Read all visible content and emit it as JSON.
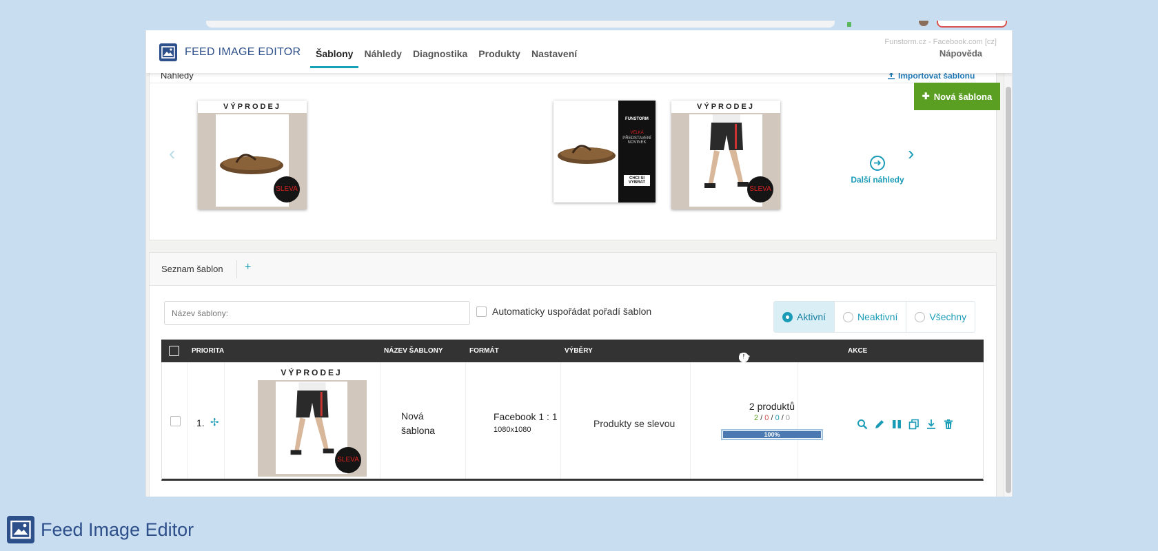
{
  "app": {
    "brand": "FEED IMAGE EDITOR",
    "account": "Funstorm.cz - Facebook.com [cz]",
    "help": "Nápověda",
    "tabs": [
      {
        "label": "Šablony",
        "active": true
      },
      {
        "label": "Náhledy",
        "active": false
      },
      {
        "label": "Diagnostika",
        "active": false
      },
      {
        "label": "Produkty",
        "active": false
      },
      {
        "label": "Nastavení",
        "active": false
      }
    ]
  },
  "previews": {
    "title": "Náhledy",
    "import_label": "Importovat šablonu",
    "new_template_label": "Nová šablona",
    "next_label": "Další náhledy",
    "banner_text": "VÝPRODEJ",
    "badge_text": "SLEVA",
    "side_banner": {
      "brand": "FUNSTORM",
      "lines": [
        "VELKÁ",
        "PŘEDSTAVENÍ NOVINEK"
      ],
      "cta": "CHCI SI VYBRAT"
    }
  },
  "list": {
    "title": "Seznam šablon",
    "search_placeholder": "Název šablony:",
    "auto_order_label": "Automaticky uspořádat pořadí šablon",
    "filters": [
      {
        "label": "Aktivní",
        "active": true
      },
      {
        "label": "Neaktivní",
        "active": false
      },
      {
        "label": "Všechny",
        "active": false
      }
    ],
    "columns": {
      "priority": "PRIORITA",
      "name": "NÁZEV ŠABLONY",
      "format": "FORMÁT",
      "selections": "VÝBĚRY",
      "actions": "AKCE",
      "status_separators": "/"
    },
    "rows": [
      {
        "priority": "1.",
        "banner": "VÝPRODEJ",
        "badge": "SLEVA",
        "name": "Nová šablona",
        "format": "Facebook 1 : 1",
        "size": "1080x1080",
        "selection": "Produkty se slevou",
        "products": "2 produktů",
        "ok": "2",
        "error": "0",
        "warn": "0",
        "skip": "0",
        "progress": "100%"
      }
    ]
  },
  "footer": {
    "label": "Feed Image Editor"
  },
  "colors": {
    "accent": "#1a9cb7",
    "brand": "#2d4f8a",
    "primary_button": "#5a9e22",
    "table_header": "#333333"
  }
}
